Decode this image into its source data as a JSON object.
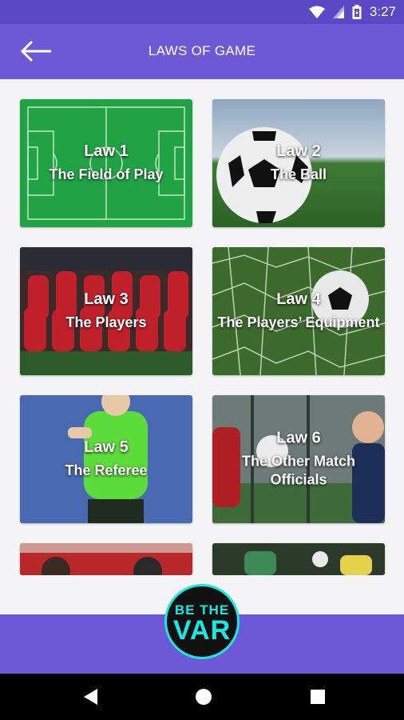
{
  "status_bar": {
    "time": "3:27",
    "icons": [
      "wifi-icon",
      "signal-icon",
      "battery-icon"
    ]
  },
  "header": {
    "title": "LAWS OF GAME",
    "back_icon": "arrow-left-icon"
  },
  "colors": {
    "status_bar": "#5b48c4",
    "app_bar": "#6d58d6",
    "logo_accent": "#19e7e0"
  },
  "laws": [
    {
      "law": "Law 1",
      "name": "The Field of Play"
    },
    {
      "law": "Law 2",
      "name": "The Ball"
    },
    {
      "law": "Law 3",
      "name": "The Players"
    },
    {
      "law": "Law 4",
      "name": "The Players’ Equipment"
    },
    {
      "law": "Law 5",
      "name": "The Referee"
    },
    {
      "law": "Law 6",
      "name": "The Other Match Officials"
    }
  ],
  "logo": {
    "line1": "BE THE",
    "line2": "VAR"
  },
  "nav": {
    "icons": [
      "back-triangle-icon",
      "home-circle-icon",
      "recents-square-icon"
    ]
  }
}
